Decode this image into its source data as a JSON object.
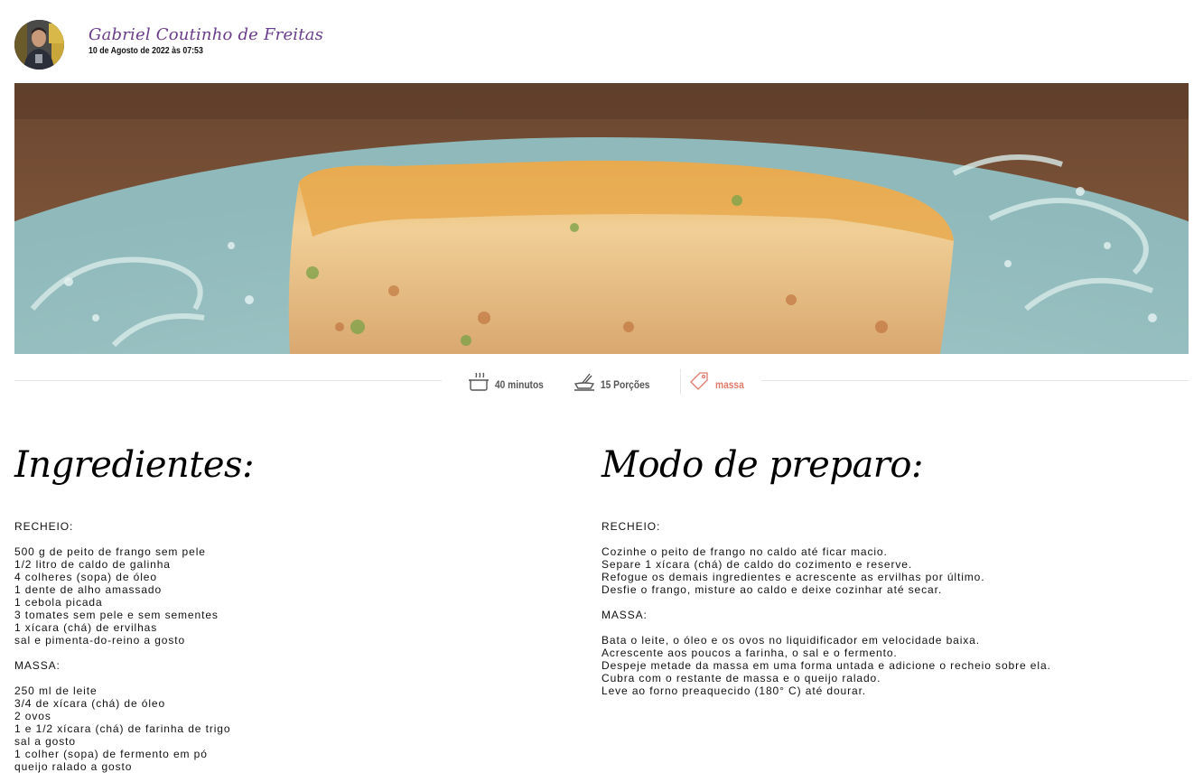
{
  "author": {
    "name": "Gabriel Coutinho de Freitas",
    "date": "10 de Agosto de 2022 às 07:53"
  },
  "meta": {
    "time": "40 minutos",
    "portions": "15 Porções",
    "tag": "massa",
    "tag_color": "#e07a6a"
  },
  "ingredients": {
    "title": "Ingredientes:",
    "sections": [
      {
        "heading": "RECHEIO:",
        "lines": [
          "500 g de peito de frango sem pele",
          "1/2 litro de caldo de galinha",
          "4 colheres (sopa) de óleo",
          "1 dente de alho amassado",
          "1 cebola picada",
          "3 tomates sem pele e sem sementes",
          "1 xícara (chá) de ervilhas",
          "sal e pimenta-do-reino a gosto"
        ]
      },
      {
        "heading": "MASSA:",
        "lines": [
          "250 ml de leite",
          "3/4 de xícara (chá) de óleo",
          "2 ovos",
          "1 e 1/2 xícara (chá) de farinha de trigo",
          "sal a gosto",
          "1 colher (sopa) de fermento em pó",
          "queijo ralado a gosto"
        ]
      }
    ]
  },
  "preparation": {
    "title": "Modo de preparo:",
    "sections": [
      {
        "heading": "RECHEIO:",
        "lines": [
          "Cozinhe o peito de frango no caldo até ficar macio.",
          "Separe 1 xícara (chá) de caldo do cozimento e reserve.",
          "Refogue os demais ingredientes e acrescente as ervilhas por último.",
          "Desfie o frango, misture ao caldo e deixe cozinhar até secar."
        ]
      },
      {
        "heading": "MASSA:",
        "lines": [
          "Bata o leite, o óleo e os ovos no liquidificador em velocidade baixa.",
          "Acrescente aos poucos a farinha, o sal e o fermento.",
          "Despeje metade da massa em uma forma untada e adicione o recheio sobre ela.",
          "Cubra com o restante de massa e o queijo ralado.",
          "Leve ao forno preaquecido (180° C) até dourar."
        ]
      }
    ]
  },
  "icons": {
    "time": "pot-icon",
    "portions": "serving-dish-icon",
    "tag": "tag-icon"
  }
}
